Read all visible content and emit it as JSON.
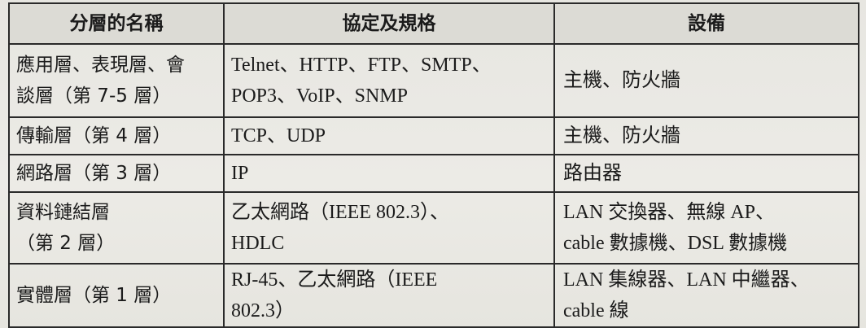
{
  "table": {
    "headers": [
      "分層的名稱",
      "協定及規格",
      "設備"
    ],
    "rows": [
      {
        "layer": [
          "應用層、表現層、會",
          "談層（第 7-5 層）"
        ],
        "protocols": [
          "Telnet、HTTP、FTP、SMTP、",
          "POP3、VoIP、SNMP"
        ],
        "devices": [
          "主機、防火牆"
        ]
      },
      {
        "layer": [
          "傳輸層（第 4 層）"
        ],
        "protocols": [
          "TCP、UDP"
        ],
        "devices": [
          "主機、防火牆"
        ]
      },
      {
        "layer": [
          "網路層（第 3 層）"
        ],
        "protocols": [
          "IP"
        ],
        "devices": [
          "路由器"
        ]
      },
      {
        "layer": [
          "資料鏈結層",
          "（第 2 層）"
        ],
        "protocols": [
          "乙太網路（IEEE 802.3）、",
          "HDLC"
        ],
        "devices": [
          "LAN 交換器、無線 AP、",
          "cable 數據機、DSL 數據機"
        ]
      },
      {
        "layer": [
          "實體層（第 1 層）"
        ],
        "protocols": [
          "RJ-45、乙太網路（IEEE",
          "802.3）"
        ],
        "devices": [
          "LAN 集線器、LAN 中繼器、",
          "cable 線"
        ]
      }
    ]
  }
}
